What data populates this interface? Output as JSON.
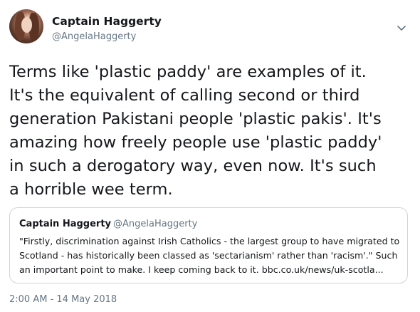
{
  "user": {
    "display_name": "Captain Haggerty",
    "handle": "@AngelaHaggerty"
  },
  "tweet": {
    "text": "Terms like 'plastic paddy' are examples of it.\nIt's the equivalent of calling second or third\ngeneration Pakistani people 'plastic pakis'. It's\namazing how freely people use 'plastic paddy'\nin such a derogatory way, even now. It's such\na horrible wee term.",
    "timestamp": "2:00 AM - 14 May 2018"
  },
  "quoted_tweet": {
    "display_name": "Captain Haggerty",
    "handle": "@AngelaHaggerty",
    "text": "\"Firstly, discrimination against Irish Catholics - the largest group to have migrated to Scotland - has historically been classed as 'sectarianism' rather than 'racism'.\" Such an important point to make. I keep coming back to it. bbc.co.uk/news/uk-scotla..."
  },
  "icons": {
    "avatar": "profile-photo",
    "menu": "chevron-down-icon"
  },
  "colors": {
    "text_primary": "#14171a",
    "text_secondary": "#657786",
    "border": "#ccd6dd",
    "background": "#ffffff"
  }
}
